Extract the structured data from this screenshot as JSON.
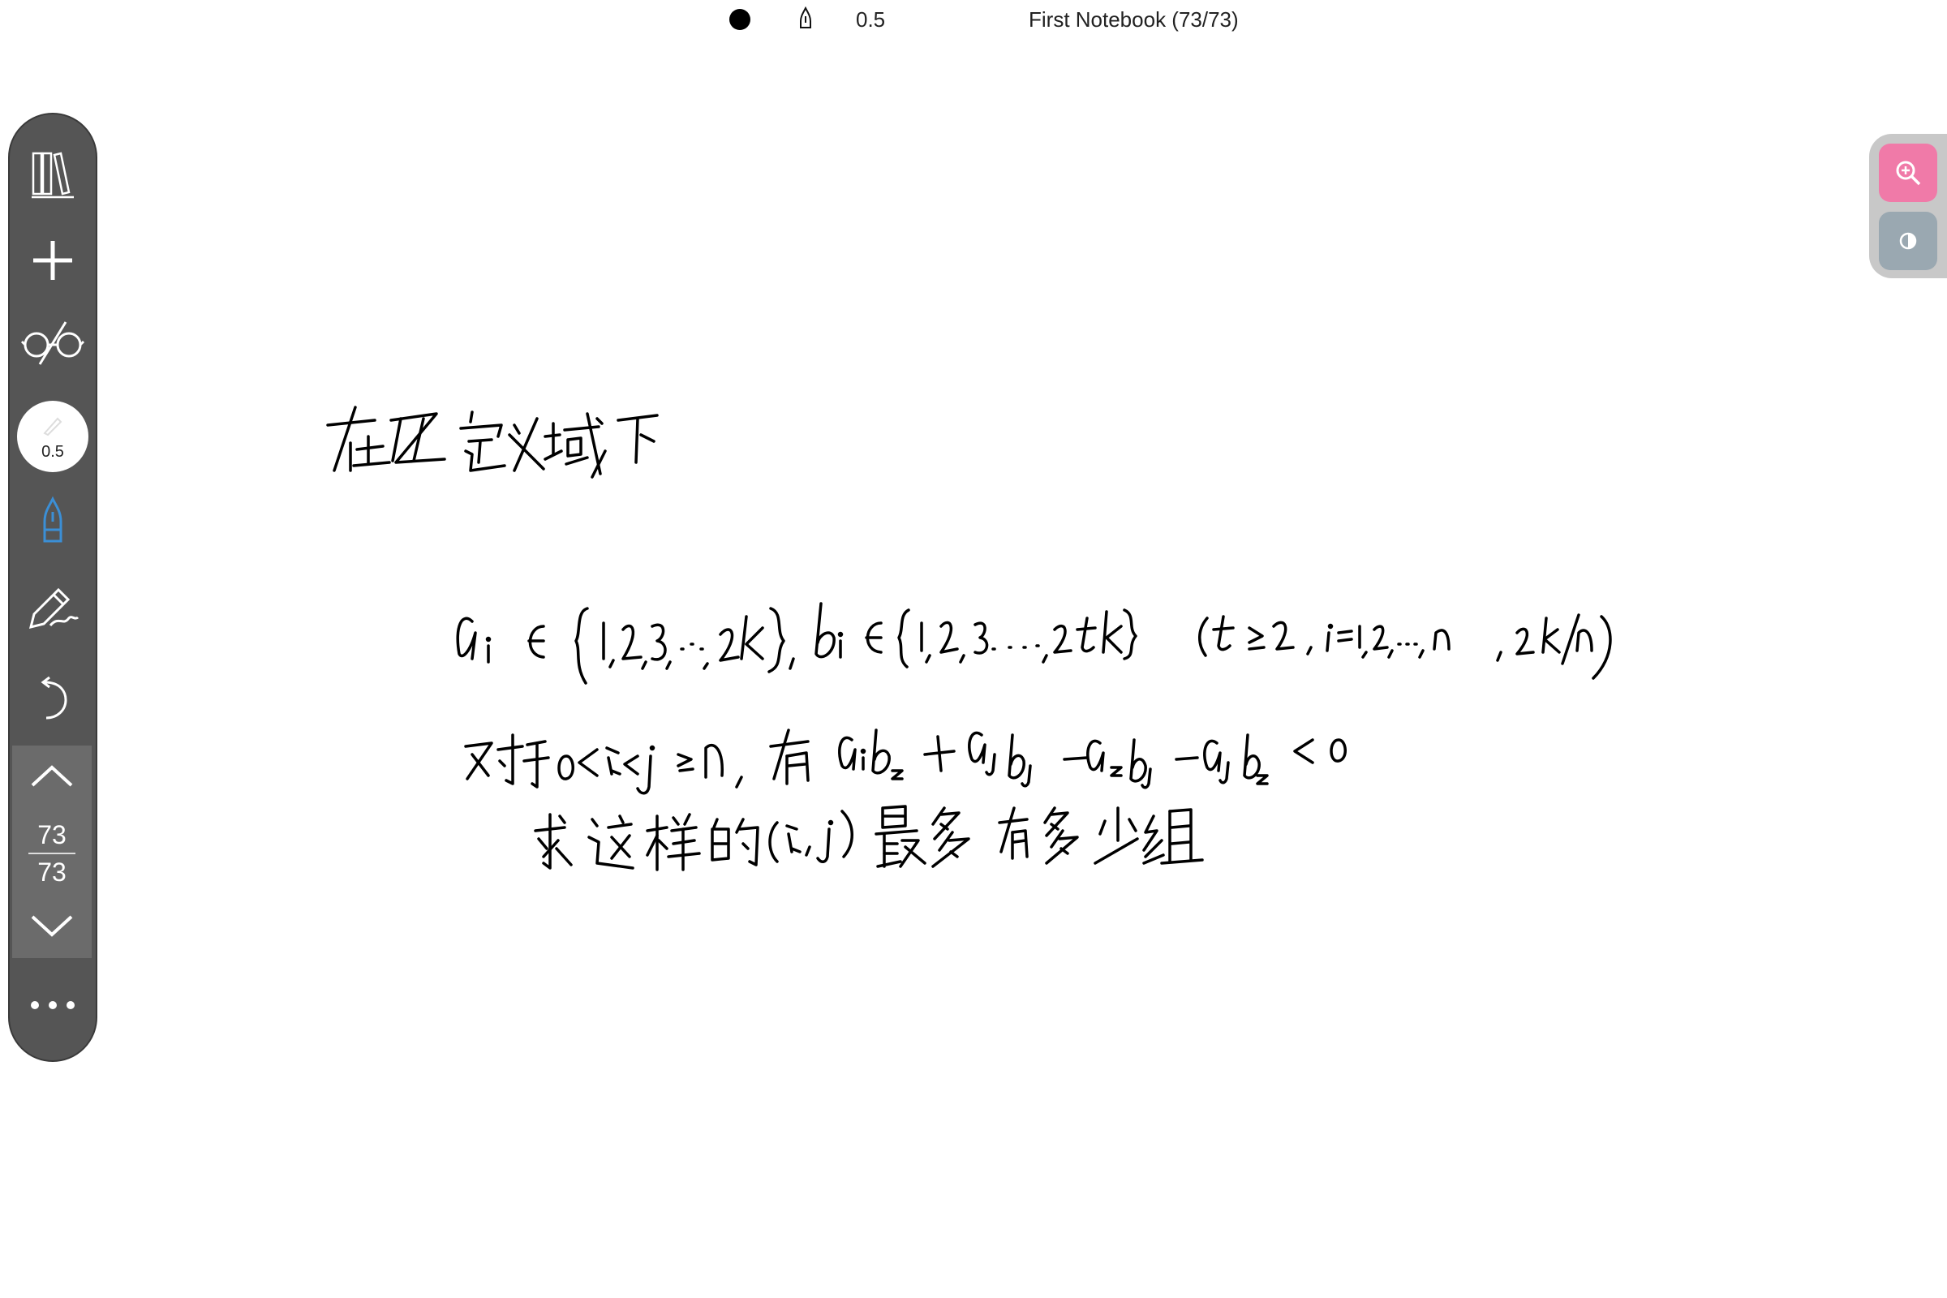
{
  "topbar": {
    "stroke_width": "0.5",
    "notebook_title": "First Notebook (73/73)",
    "pen_color": "#000000"
  },
  "toolbar": {
    "items": [
      {
        "name": "library",
        "icon": "books-icon"
      },
      {
        "name": "add-page",
        "icon": "plus-icon"
      },
      {
        "name": "view-mode",
        "icon": "glasses-icon"
      },
      {
        "name": "pen-size",
        "icon": "pen-size-icon",
        "label": "0.5"
      },
      {
        "name": "pen",
        "icon": "fountain-pen-icon",
        "active": true,
        "active_color": "#3b8fd6"
      },
      {
        "name": "pencil",
        "icon": "pencil-icon"
      },
      {
        "name": "undo",
        "icon": "undo-icon"
      },
      {
        "name": "more",
        "icon": "more-dots-icon"
      }
    ],
    "pen_size_label": "0.5",
    "page_current": "73",
    "page_total": "73",
    "background": "#555555"
  },
  "right_panel": {
    "zoom_color": "#f07aa8",
    "contrast_color": "#9aa8b1"
  },
  "handwriting": {
    "description_lines": [
      "在 ℤ 定义域下",
      "aᵢ ∈ {1,2,3,⋯,2k}, bᵢ ∈ {1,2,3,⋯,2tk}   (t ≥ 2, i=1,2,⋯,n, 2k|n)",
      "对于 0<i<j≤n, 有 aᵢbᵢ + aⱼbⱼ − aᵢbⱼ − aⱼbᵢ < 0",
      "求这样的 (i,j) 最多有多少组"
    ]
  }
}
